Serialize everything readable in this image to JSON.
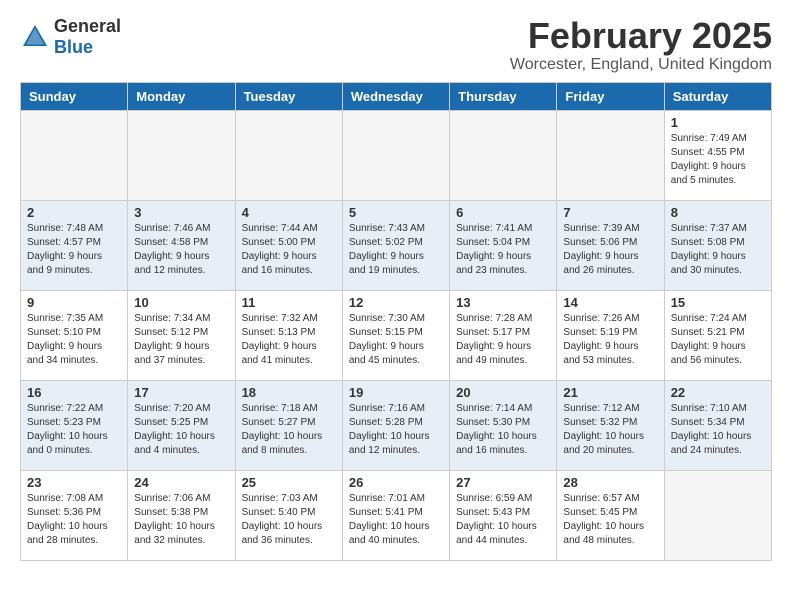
{
  "logo": {
    "general": "General",
    "blue": "Blue"
  },
  "title": "February 2025",
  "location": "Worcester, England, United Kingdom",
  "headers": [
    "Sunday",
    "Monday",
    "Tuesday",
    "Wednesday",
    "Thursday",
    "Friday",
    "Saturday"
  ],
  "weeks": [
    [
      {
        "day": "",
        "info": ""
      },
      {
        "day": "",
        "info": ""
      },
      {
        "day": "",
        "info": ""
      },
      {
        "day": "",
        "info": ""
      },
      {
        "day": "",
        "info": ""
      },
      {
        "day": "",
        "info": ""
      },
      {
        "day": "1",
        "info": "Sunrise: 7:49 AM\nSunset: 4:55 PM\nDaylight: 9 hours and 5 minutes."
      }
    ],
    [
      {
        "day": "2",
        "info": "Sunrise: 7:48 AM\nSunset: 4:57 PM\nDaylight: 9 hours and 9 minutes."
      },
      {
        "day": "3",
        "info": "Sunrise: 7:46 AM\nSunset: 4:58 PM\nDaylight: 9 hours and 12 minutes."
      },
      {
        "day": "4",
        "info": "Sunrise: 7:44 AM\nSunset: 5:00 PM\nDaylight: 9 hours and 16 minutes."
      },
      {
        "day": "5",
        "info": "Sunrise: 7:43 AM\nSunset: 5:02 PM\nDaylight: 9 hours and 19 minutes."
      },
      {
        "day": "6",
        "info": "Sunrise: 7:41 AM\nSunset: 5:04 PM\nDaylight: 9 hours and 23 minutes."
      },
      {
        "day": "7",
        "info": "Sunrise: 7:39 AM\nSunset: 5:06 PM\nDaylight: 9 hours and 26 minutes."
      },
      {
        "day": "8",
        "info": "Sunrise: 7:37 AM\nSunset: 5:08 PM\nDaylight: 9 hours and 30 minutes."
      }
    ],
    [
      {
        "day": "9",
        "info": "Sunrise: 7:35 AM\nSunset: 5:10 PM\nDaylight: 9 hours and 34 minutes."
      },
      {
        "day": "10",
        "info": "Sunrise: 7:34 AM\nSunset: 5:12 PM\nDaylight: 9 hours and 37 minutes."
      },
      {
        "day": "11",
        "info": "Sunrise: 7:32 AM\nSunset: 5:13 PM\nDaylight: 9 hours and 41 minutes."
      },
      {
        "day": "12",
        "info": "Sunrise: 7:30 AM\nSunset: 5:15 PM\nDaylight: 9 hours and 45 minutes."
      },
      {
        "day": "13",
        "info": "Sunrise: 7:28 AM\nSunset: 5:17 PM\nDaylight: 9 hours and 49 minutes."
      },
      {
        "day": "14",
        "info": "Sunrise: 7:26 AM\nSunset: 5:19 PM\nDaylight: 9 hours and 53 minutes."
      },
      {
        "day": "15",
        "info": "Sunrise: 7:24 AM\nSunset: 5:21 PM\nDaylight: 9 hours and 56 minutes."
      }
    ],
    [
      {
        "day": "16",
        "info": "Sunrise: 7:22 AM\nSunset: 5:23 PM\nDaylight: 10 hours and 0 minutes."
      },
      {
        "day": "17",
        "info": "Sunrise: 7:20 AM\nSunset: 5:25 PM\nDaylight: 10 hours and 4 minutes."
      },
      {
        "day": "18",
        "info": "Sunrise: 7:18 AM\nSunset: 5:27 PM\nDaylight: 10 hours and 8 minutes."
      },
      {
        "day": "19",
        "info": "Sunrise: 7:16 AM\nSunset: 5:28 PM\nDaylight: 10 hours and 12 minutes."
      },
      {
        "day": "20",
        "info": "Sunrise: 7:14 AM\nSunset: 5:30 PM\nDaylight: 10 hours and 16 minutes."
      },
      {
        "day": "21",
        "info": "Sunrise: 7:12 AM\nSunset: 5:32 PM\nDaylight: 10 hours and 20 minutes."
      },
      {
        "day": "22",
        "info": "Sunrise: 7:10 AM\nSunset: 5:34 PM\nDaylight: 10 hours and 24 minutes."
      }
    ],
    [
      {
        "day": "23",
        "info": "Sunrise: 7:08 AM\nSunset: 5:36 PM\nDaylight: 10 hours and 28 minutes."
      },
      {
        "day": "24",
        "info": "Sunrise: 7:06 AM\nSunset: 5:38 PM\nDaylight: 10 hours and 32 minutes."
      },
      {
        "day": "25",
        "info": "Sunrise: 7:03 AM\nSunset: 5:40 PM\nDaylight: 10 hours and 36 minutes."
      },
      {
        "day": "26",
        "info": "Sunrise: 7:01 AM\nSunset: 5:41 PM\nDaylight: 10 hours and 40 minutes."
      },
      {
        "day": "27",
        "info": "Sunrise: 6:59 AM\nSunset: 5:43 PM\nDaylight: 10 hours and 44 minutes."
      },
      {
        "day": "28",
        "info": "Sunrise: 6:57 AM\nSunset: 5:45 PM\nDaylight: 10 hours and 48 minutes."
      },
      {
        "day": "",
        "info": ""
      }
    ]
  ]
}
